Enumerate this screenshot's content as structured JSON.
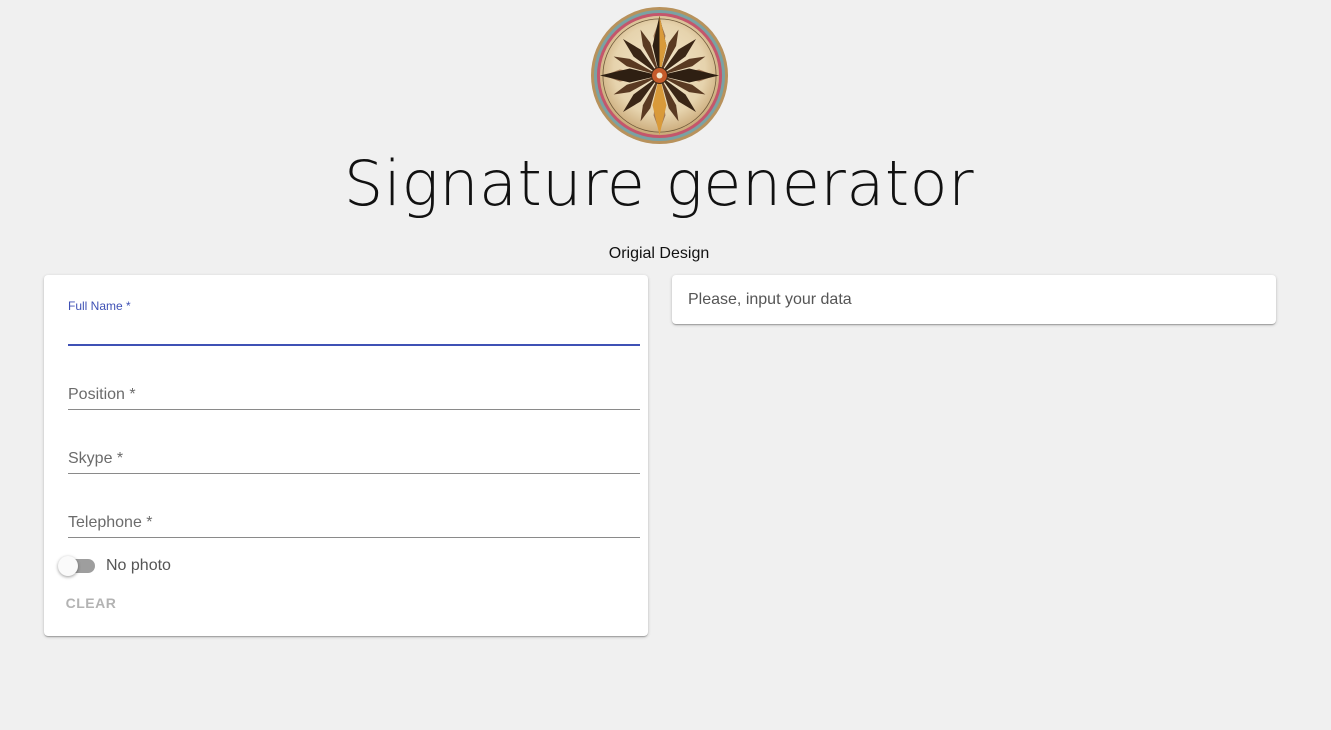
{
  "header": {
    "logo_icon": "compass-rose-icon",
    "title": "Signature generator",
    "subtitle": "Origial Design"
  },
  "form": {
    "fields": [
      {
        "label": "Full Name *",
        "value": "",
        "focused": true
      },
      {
        "label": "Position *",
        "value": "",
        "focused": false
      },
      {
        "label": "Skype *",
        "value": "",
        "focused": false
      },
      {
        "label": "Telephone *",
        "value": "",
        "focused": false
      }
    ],
    "photo_toggle": {
      "label": "No photo",
      "checked": false
    },
    "clear_label": "CLEAR"
  },
  "preview": {
    "placeholder_text": "Please, input your data"
  },
  "colors": {
    "background": "#f0f0f0",
    "accent": "#3f51b5",
    "card": "#ffffff",
    "disabled_text": "#b3b3b3"
  }
}
